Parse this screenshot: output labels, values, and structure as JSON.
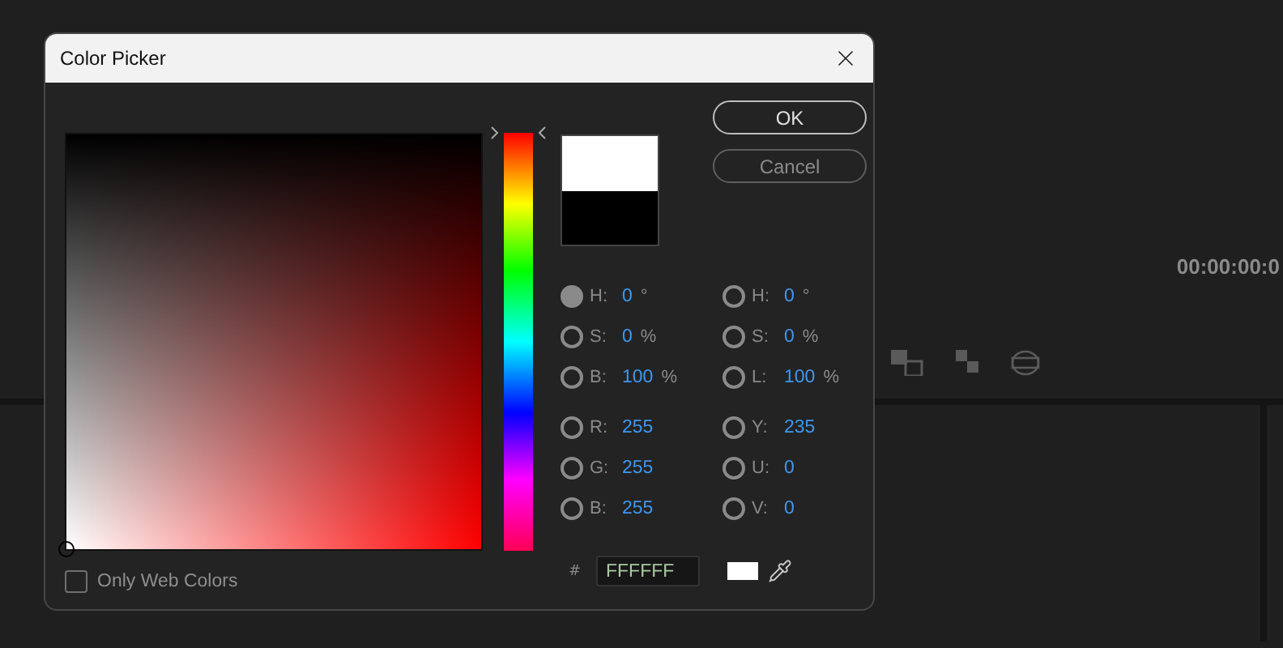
{
  "background": {
    "timecode": "00:00:00:0"
  },
  "dialog": {
    "title": "Color Picker",
    "buttons": [
      {
        "label": "OK",
        "kind": "primary"
      },
      {
        "label": "Cancel",
        "kind": "secondary"
      }
    ],
    "left_fields": [
      {
        "label": "H:",
        "value": "0",
        "unit": "°",
        "selected": true
      },
      {
        "label": "S:",
        "value": "0",
        "unit": "%",
        "selected": false
      },
      {
        "label": "B:",
        "value": "100",
        "unit": "%",
        "selected": false
      },
      {
        "label": "R:",
        "value": "255",
        "selected": false
      },
      {
        "label": "G:",
        "value": "255",
        "selected": false
      },
      {
        "label": "B:",
        "value": "255",
        "selected": false
      }
    ],
    "right_fields": [
      {
        "label": "H:",
        "value": "0",
        "unit": "°",
        "selected": false
      },
      {
        "label": "S:",
        "value": "0",
        "unit": "%",
        "selected": false
      },
      {
        "label": "L:",
        "value": "100",
        "unit": "%",
        "selected": false
      },
      {
        "label": "Y:",
        "value": "235",
        "selected": false
      },
      {
        "label": "U:",
        "value": "0",
        "selected": false
      },
      {
        "label": "V:",
        "value": "0",
        "selected": false
      }
    ],
    "hue_slider": {
      "level": 0
    },
    "hex": {
      "label": "#",
      "value": "FFFFFF"
    },
    "web_colors": {
      "label": "Only Web Colors",
      "checked": false
    }
  }
}
